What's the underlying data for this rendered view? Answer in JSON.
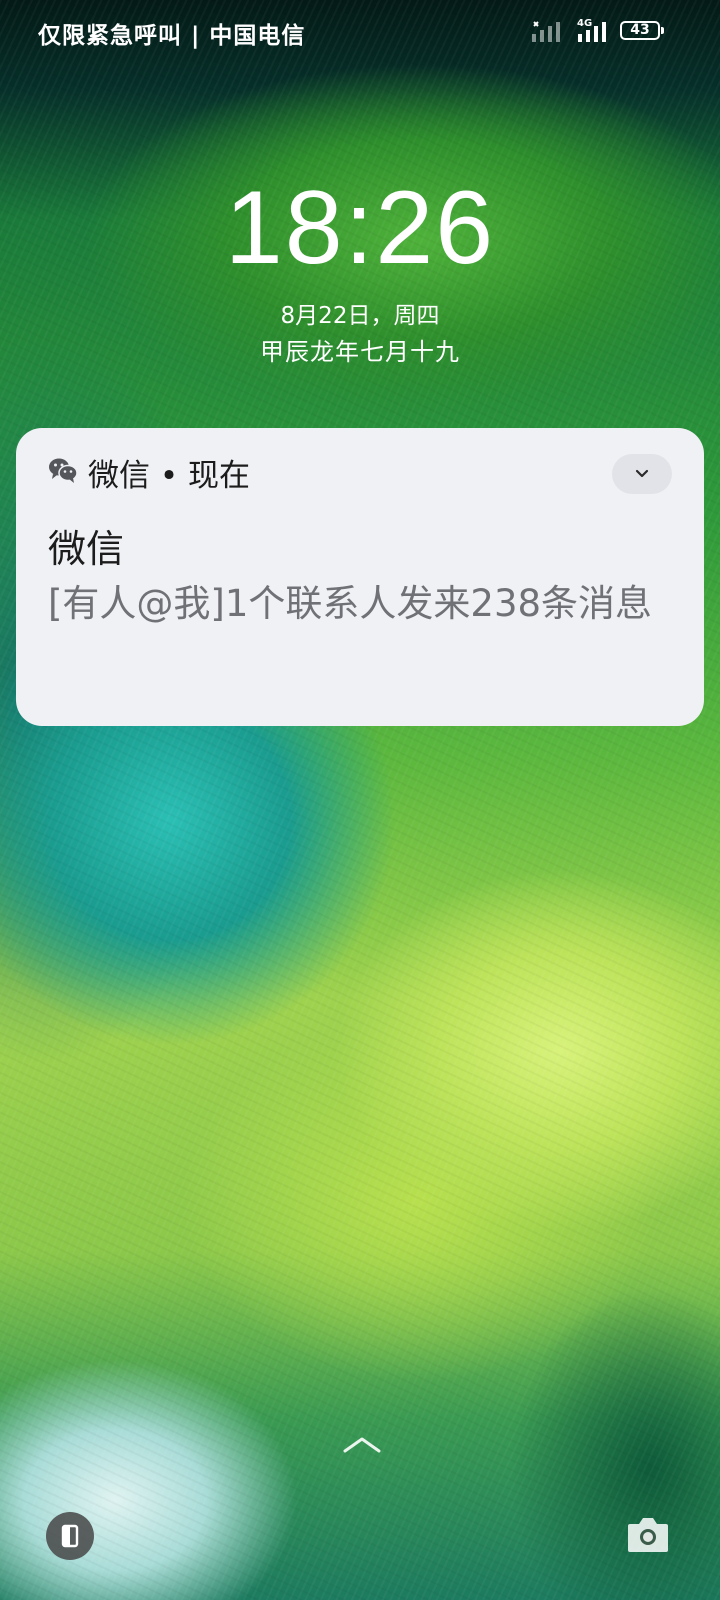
{
  "status_bar": {
    "carrier_text": "仅限紧急呼叫 | 中国电信",
    "network_label": "4G",
    "battery_level": "43"
  },
  "clock": {
    "time": "18:26",
    "date": "8月22日，周四",
    "lunar_date": "甲辰龙年七月十九"
  },
  "notification": {
    "app_icon": "wechat-icon",
    "header": "微信 • 现在",
    "title": "微信",
    "body": "[有人@我]1个联系人发来238条消息"
  },
  "bottom": {
    "unlock_icon": "chevron-up-icon",
    "left_shortcut_icon": "phone-shortcut-icon",
    "right_shortcut_icon": "camera-icon"
  },
  "colors": {
    "notification_bg": "#f0f1f5",
    "notification_text": "#1c1c1c",
    "notification_body": "#707177"
  }
}
